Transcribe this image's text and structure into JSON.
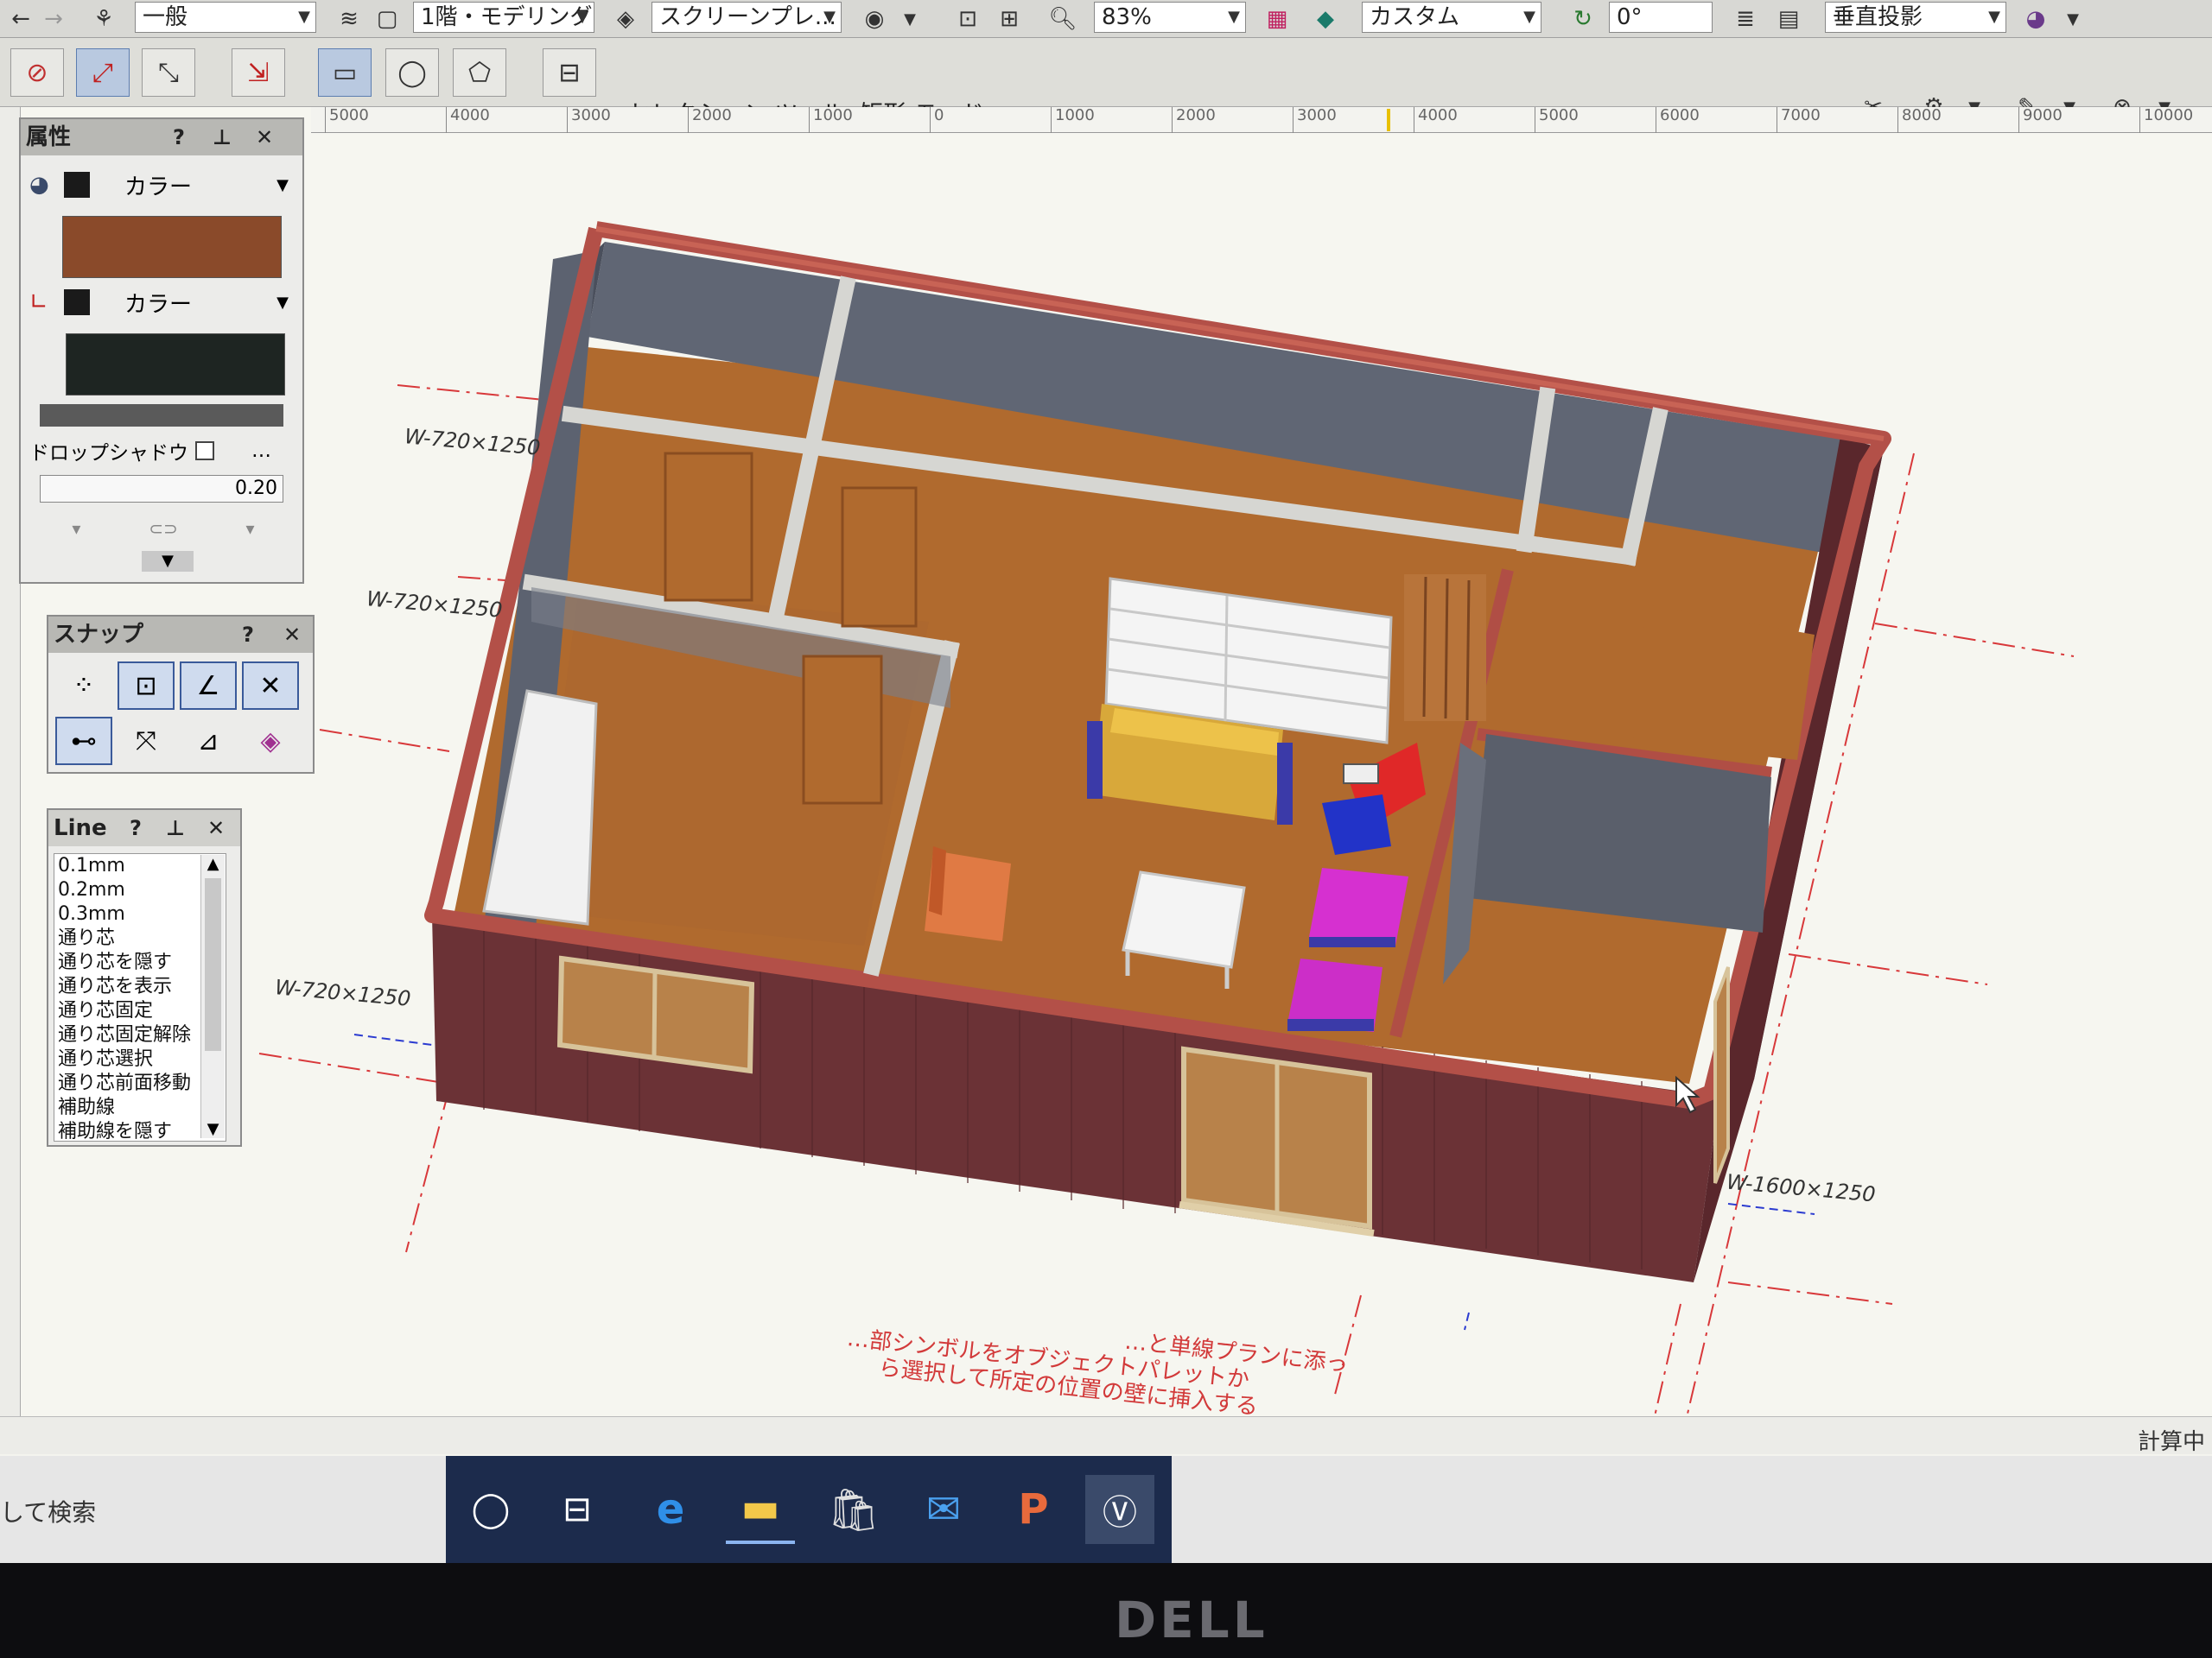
{
  "toolbar1": {
    "class_select": "一般",
    "layer_select": "1階・モデリング",
    "view_select": "スクリーンプレ...",
    "zoom": "83%",
    "render_select": "カスタム",
    "angle": "0°",
    "projection_select": "垂直投影"
  },
  "toolbar2": {
    "mode_label": "セレクション ツール: 矩形 モード"
  },
  "ruler": {
    "ticks": [
      "5000",
      "4000",
      "3000",
      "2000",
      "1000",
      "0",
      "1000",
      "2000",
      "3000",
      "4000",
      "5000",
      "6000",
      "7000",
      "8000",
      "9000",
      "10000"
    ]
  },
  "attributes_palette": {
    "title": "属性",
    "fill_label": "カラー",
    "pen_label": "カラー",
    "fill_color": "#8a4a2a",
    "pen_color": "#1e2522",
    "drop_shadow_label": "ドロップシャドウ",
    "drop_shadow_more": "…",
    "line_weight": "0.20"
  },
  "snap_palette": {
    "title": "スナップ"
  },
  "line_palette": {
    "title": "Line",
    "items": [
      "0.1mm",
      "0.2mm",
      "0.3mm",
      "通り芯",
      "通り芯を隠す",
      "通り芯を表示",
      "通り芯固定",
      "通り芯固定解除",
      "通り芯選択",
      "通り芯前面移動",
      "補助線",
      "補助線を隠す"
    ]
  },
  "drawing": {
    "dim_labels": [
      "W-720×1250",
      "W-720×1250",
      "W-720×1250",
      "W-1600×1250"
    ],
    "note_lines": [
      "…部シンボルをオブジェクトパレットか",
      "…と単線プランに添っ",
      "ら選択して所定の位置の壁に挿入する"
    ]
  },
  "status": {
    "right_label": "計算中"
  },
  "taskbar": {
    "search_label": "して検索"
  },
  "bezel": {
    "brand": "DELL"
  }
}
